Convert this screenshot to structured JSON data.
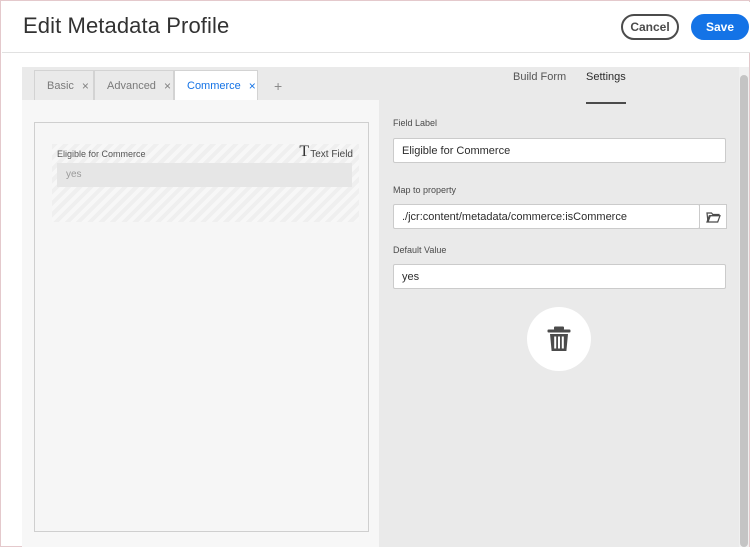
{
  "header": {
    "title": "Edit Metadata Profile",
    "cancel_label": "Cancel",
    "save_label": "Save"
  },
  "tabs": [
    {
      "label": "Basic",
      "active": false
    },
    {
      "label": "Advanced",
      "active": false
    },
    {
      "label": "Commerce",
      "active": true
    }
  ],
  "tab_add_label": "+",
  "tab_close_glyph": "×",
  "form_canvas": {
    "field_label": "Eligible for Commerce",
    "field_type_glyph": "T",
    "field_type_label": "Text Field",
    "preview_value": "yes"
  },
  "panel_tabs": {
    "build_form": "Build Form",
    "settings": "Settings",
    "active": "Settings"
  },
  "settings": {
    "field_label_title": "Field Label",
    "field_label_value": "Eligible for Commerce",
    "map_title": "Map to property",
    "map_value": "./jcr:content/metadata/commerce:isCommerce",
    "default_title": "Default Value",
    "default_value": "yes"
  },
  "icons": {
    "browse": "folder-icon",
    "delete": "trash-icon",
    "close": "close-icon",
    "add": "plus-icon",
    "text_field": "text-field-icon"
  },
  "colors": {
    "accent": "#1473e6",
    "panel_bg": "#eaeaea"
  }
}
